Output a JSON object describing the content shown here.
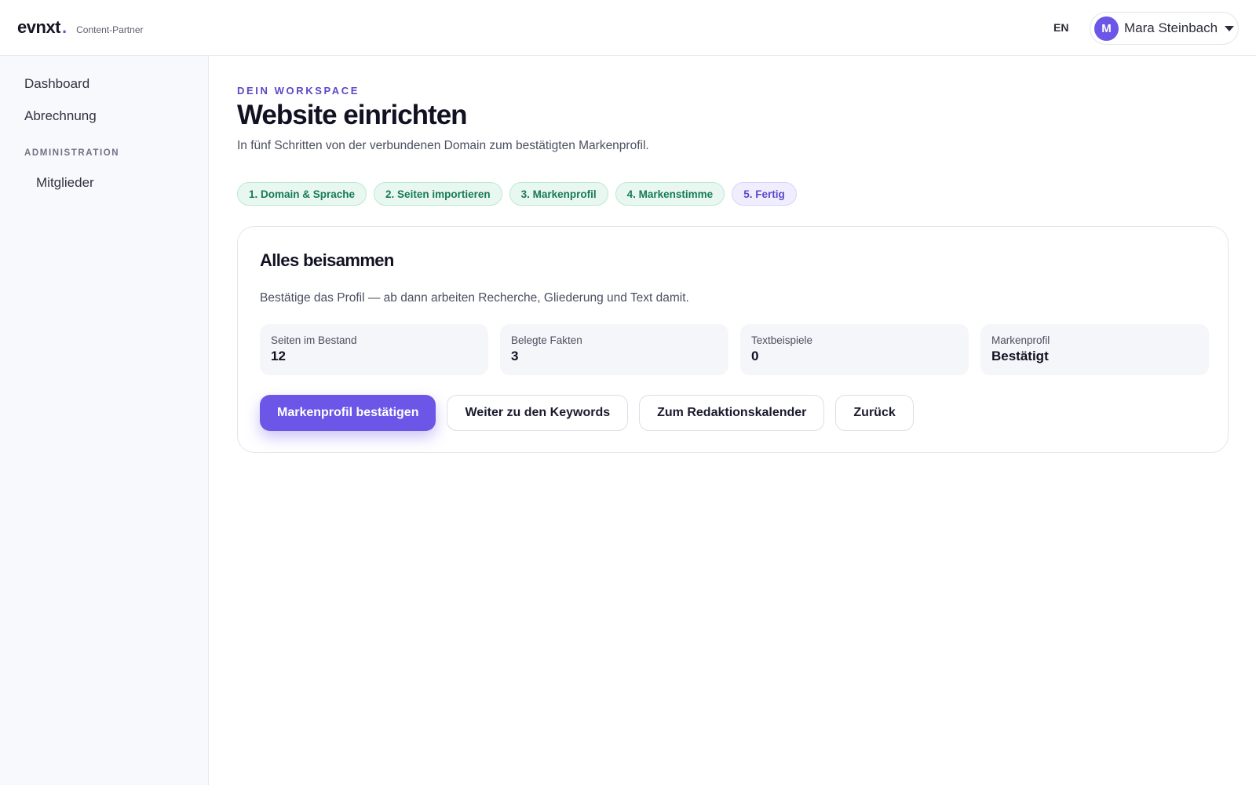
{
  "app": {
    "logo": "evnxt",
    "logo_dot": ".",
    "subtitle": "Content-Partner",
    "accent_color": "#6b56e8"
  },
  "header": {
    "language": "EN",
    "user": {
      "initial": "M",
      "name": "Mara Steinbach"
    }
  },
  "sidebar": {
    "items": [
      {
        "label": "Dashboard"
      },
      {
        "label": "Abrechnung"
      }
    ],
    "section_label": "ADMINISTRATION",
    "section_items": [
      {
        "label": "Mitglieder"
      }
    ]
  },
  "page": {
    "eyebrow": "DEIN WORKSPACE",
    "title": "Website einrichten",
    "subtitle": "In fünf Schritten von der verbundenen Domain zum bestätigten Markenprofil."
  },
  "steps": [
    {
      "label": "1. Domain & Sprache",
      "state": "done"
    },
    {
      "label": "2. Seiten importieren",
      "state": "done"
    },
    {
      "label": "3. Markenprofil",
      "state": "done"
    },
    {
      "label": "4. Markenstimme",
      "state": "done"
    },
    {
      "label": "5. Fertig",
      "state": "active"
    }
  ],
  "card": {
    "title": "Alles beisammen",
    "description": "Bestätige das Profil — ab dann arbeiten Recherche, Gliederung und Text damit.",
    "stats": [
      {
        "label": "Seiten im Bestand",
        "value": "12"
      },
      {
        "label": "Belegte Fakten",
        "value": "3"
      },
      {
        "label": "Textbeispiele",
        "value": "0"
      },
      {
        "label": "Markenprofil",
        "value": "Bestätigt"
      }
    ],
    "actions": {
      "primary": "Markenprofil bestätigen",
      "keywords": "Weiter zu den Keywords",
      "calendar": "Zum Redaktionskalender",
      "back": "Zurück"
    }
  }
}
